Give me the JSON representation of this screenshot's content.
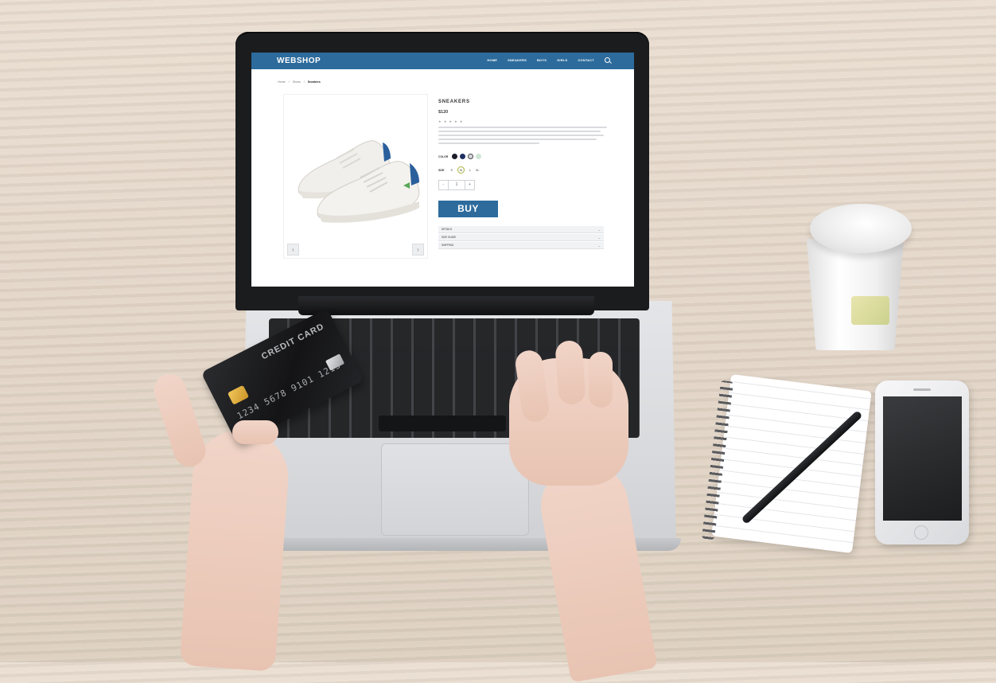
{
  "scene": {
    "objects": [
      "laptop",
      "credit-card",
      "hands",
      "coffee-cup",
      "notebook",
      "pen",
      "smartphone"
    ]
  },
  "webshop": {
    "brand": "WEBSHOP",
    "menu": [
      "HOME",
      "SNEAKERS",
      "BOYS",
      "GIRLS",
      "CONTACT"
    ],
    "breadcrumb": [
      "Home",
      "Shoes",
      "Sneakers"
    ],
    "product": {
      "title": "SNEAKERS",
      "price": "$120",
      "rating": 5,
      "rating_stars": "★ ★ ★ ★ ★",
      "color_label": "COLOR",
      "colors": [
        "#1b1d2a",
        "#1f2f63",
        "#d7d9dc",
        "#cfe6d6"
      ],
      "size_label": "SIZE",
      "sizes": [
        "S",
        "M",
        "L",
        "XL"
      ],
      "selected_size": "M",
      "quantity": {
        "minus": "-",
        "value": "1",
        "plus": "+"
      },
      "buy_label": "BUY",
      "accordion": [
        "DETAILS",
        "SIZE GUIDE",
        "SHIPPING"
      ]
    },
    "gallery": {
      "prev": "‹",
      "next": "›"
    },
    "colors": {
      "accent": "#2c6b9c"
    }
  },
  "card": {
    "label": "CREDIT CARD",
    "number": "1234 5678 9101 1213"
  }
}
